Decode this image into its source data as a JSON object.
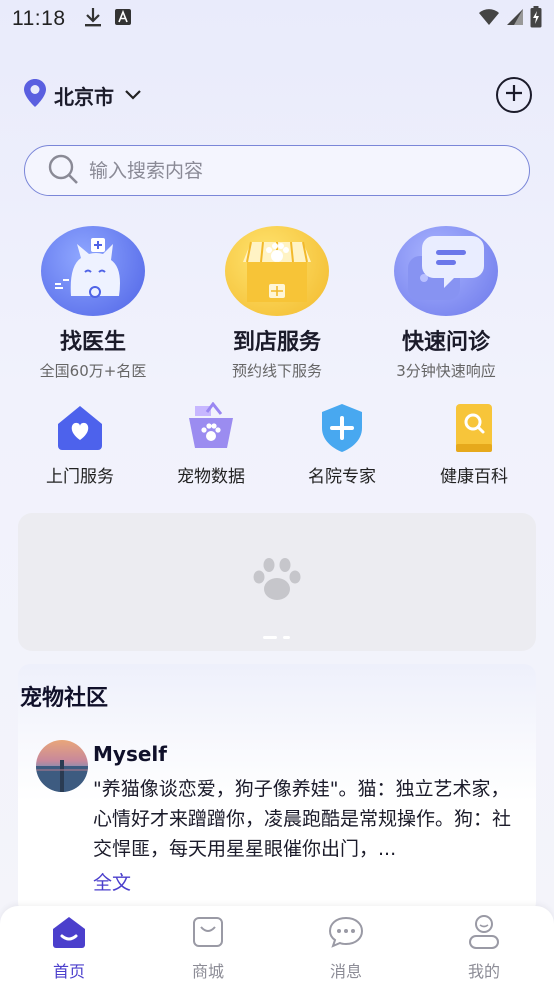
{
  "status_bar": {
    "time": "11:18"
  },
  "location": {
    "city": "北京市"
  },
  "search": {
    "placeholder": "输入搜索内容"
  },
  "big_services": [
    {
      "title": "找医生",
      "subtitle": "全国60万+名医",
      "icon": "doctor-cat-icon"
    },
    {
      "title": "到店服务",
      "subtitle": "预约线下服务",
      "icon": "pet-store-icon"
    },
    {
      "title": "快速问诊",
      "subtitle": "3分钟快速响应",
      "icon": "chat-bubble-icon"
    }
  ],
  "small_services": [
    {
      "label": "上门服务",
      "icon": "home-heart-icon"
    },
    {
      "label": "宠物数据",
      "icon": "pet-basket-icon"
    },
    {
      "label": "名院专家",
      "icon": "shield-plus-icon"
    },
    {
      "label": "健康百科",
      "icon": "book-search-icon"
    }
  ],
  "community": {
    "heading": "宠物社区",
    "post": {
      "user": "Myself",
      "text": "\"养猫像谈恋爱，狗子像养娃\"。猫：独立艺术家，心情好才来蹭蹭你，凌晨跑酷是常规操作。狗：社交悍匪，每天用星星眼催你出门，...",
      "more": "全文"
    }
  },
  "bottom_nav": [
    {
      "label": "首页",
      "icon": "home-icon",
      "active": true
    },
    {
      "label": "商城",
      "icon": "shopping-bag-icon",
      "active": false
    },
    {
      "label": "消息",
      "icon": "message-icon",
      "active": false
    },
    {
      "label": "我的",
      "icon": "profile-icon",
      "active": false
    }
  ],
  "colors": {
    "accent": "#4b3fcc",
    "search_border": "#7a86d8",
    "banner_bg": "#ececf1"
  }
}
